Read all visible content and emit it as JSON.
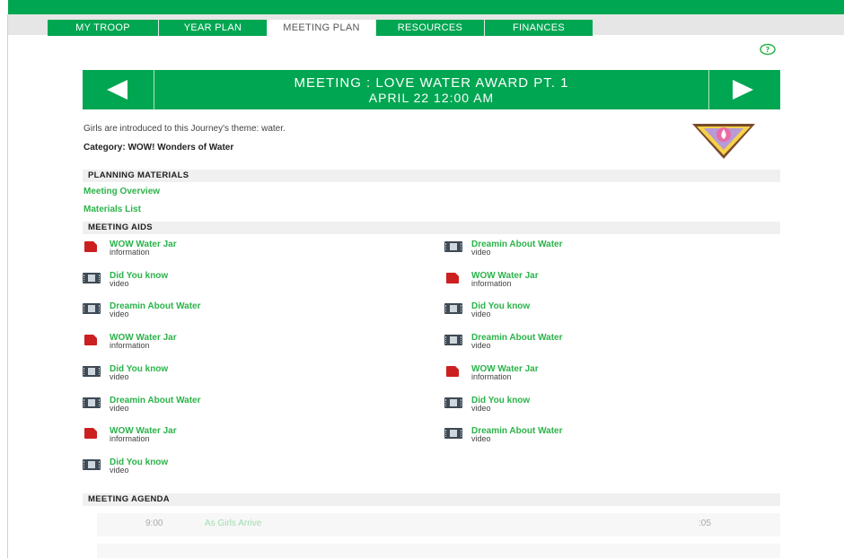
{
  "nav": {
    "tabs": [
      {
        "label": "MY TROOP",
        "active": false
      },
      {
        "label": "YEAR PLAN",
        "active": false
      },
      {
        "label": "MEETING PLAN",
        "active": true
      },
      {
        "label": "RESOURCES",
        "active": false
      },
      {
        "label": "FINANCES",
        "active": false
      }
    ]
  },
  "help_icon": "help-circle-icon",
  "meeting": {
    "title": "MEETING : LOVE WATER AWARD PT. 1",
    "date": "APRIL 22 12:00 AM",
    "prev_icon": "arrow-left-icon",
    "next_icon": "arrow-right-icon",
    "description": "Girls are introduced to this Journey's theme: water.",
    "category": "Category: WOW! Wonders of Water",
    "badge_icon": "love-water-award-badge"
  },
  "planning_materials": {
    "heading": "PLANNING MATERIALS",
    "links": [
      "Meeting Overview",
      "Materials List"
    ]
  },
  "meeting_aids": {
    "heading": "MEETING AIDS",
    "left": [
      {
        "title": "WOW Water Jar",
        "type": "information",
        "icon": "document-icon"
      },
      {
        "title": "Did You know",
        "type": "video",
        "icon": "video-icon"
      },
      {
        "title": "Dreamin About Water",
        "type": "video",
        "icon": "video-icon"
      },
      {
        "title": "WOW Water Jar",
        "type": "information",
        "icon": "document-icon"
      },
      {
        "title": "Did You know",
        "type": "video",
        "icon": "video-icon"
      },
      {
        "title": "Dreamin About Water",
        "type": "video",
        "icon": "video-icon"
      },
      {
        "title": "WOW Water Jar",
        "type": "information",
        "icon": "document-icon"
      },
      {
        "title": "Did You know",
        "type": "video",
        "icon": "video-icon"
      }
    ],
    "right": [
      {
        "title": "Dreamin About Water",
        "type": "video",
        "icon": "video-icon"
      },
      {
        "title": "WOW Water Jar",
        "type": "information",
        "icon": "document-icon"
      },
      {
        "title": "Did You know",
        "type": "video",
        "icon": "video-icon"
      },
      {
        "title": "Dreamin About Water",
        "type": "video",
        "icon": "video-icon"
      },
      {
        "title": "WOW Water Jar",
        "type": "information",
        "icon": "document-icon"
      },
      {
        "title": "Did You know",
        "type": "video",
        "icon": "video-icon"
      },
      {
        "title": "Dreamin About Water",
        "type": "video",
        "icon": "video-icon"
      }
    ]
  },
  "agenda": {
    "heading": "MEETING AGENDA",
    "rows": [
      {
        "time": "9:00",
        "item": "As Girls Arrive",
        "duration": ":05"
      }
    ]
  },
  "colors": {
    "brand_green": "#00a651",
    "link_green": "#2bb34a",
    "document_red": "#cc1f1f"
  }
}
